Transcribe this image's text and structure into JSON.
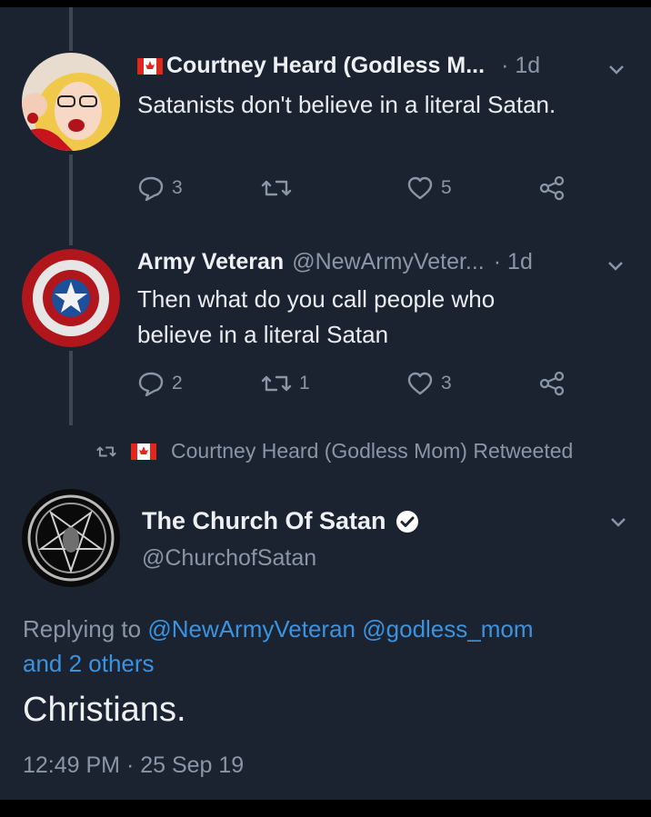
{
  "tweet1": {
    "name": "Courtney Heard (Godless M...",
    "time": "· 1d",
    "text": "Satanists don't believe in a literal Satan.",
    "replies": "3",
    "retweets": "",
    "likes": "5"
  },
  "tweet2": {
    "name": "Army Veteran",
    "handle": "@NewArmyVeter...",
    "time": "· 1d",
    "text_line1": "Then what do you call people who",
    "text_line2": "believe in a literal Satan",
    "replies": "2",
    "retweets": "1",
    "likes": "3"
  },
  "retweet_banner": "Courtney Heard (Godless Mom) Retweeted",
  "main_tweet": {
    "name": "The Church Of Satan",
    "handle": "@ChurchofSatan",
    "replying_prefix": "Replying to",
    "replying_user1": "@NewArmyVeteran",
    "replying_user2": "@godless_mom",
    "replying_others": "and 2 others",
    "text": "Christians.",
    "timestamp": "12:49 PM · 25 Sep 19"
  },
  "colors": {
    "background": "#1b2330",
    "link": "#3b93e0",
    "muted": "#8a96a4"
  },
  "icons": [
    "canada-flag-icon",
    "chevron-down-icon",
    "reply-icon",
    "retweet-icon",
    "like-icon",
    "share-icon",
    "verified-badge-icon"
  ]
}
